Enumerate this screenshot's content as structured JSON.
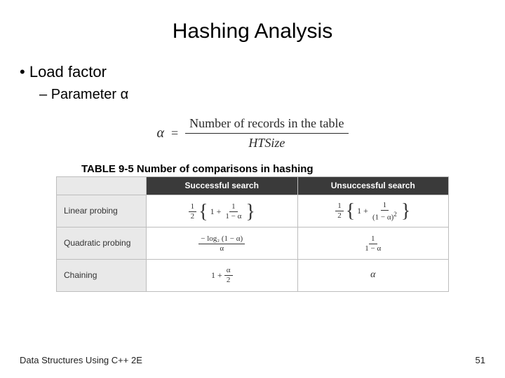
{
  "title": "Hashing Analysis",
  "bullets": {
    "l1": "Load factor",
    "l2": "Parameter α"
  },
  "formula": {
    "lhs": "α",
    "eq": "=",
    "num": "Number of records in the table",
    "den": "HTSize"
  },
  "table": {
    "caption": "TABLE 9-5 Number of comparisons in hashing",
    "headers": {
      "c0": "",
      "c1": "Successful search",
      "c2": "Unsuccessful search"
    },
    "rows": {
      "r0": {
        "label": "Linear probing"
      },
      "r1": {
        "label": "Quadratic probing"
      },
      "r2": {
        "label": "Chaining"
      }
    },
    "cells": {
      "lp_s": {
        "half": "1",
        "two": "2",
        "one": "1",
        "plus": "+",
        "innerNum": "1",
        "innerDen": "1 − α"
      },
      "lp_u": {
        "half": "1",
        "two": "2",
        "one": "1",
        "plus": "+",
        "innerNum": "1",
        "innerDen": "(1 − α)",
        "sq": "2"
      },
      "qp_s": {
        "num": "− log₂ (1 − α)",
        "den": "α"
      },
      "qp_u": {
        "num": "1",
        "den": "1 − α"
      },
      "ch_s": {
        "one": "1",
        "plus": "+",
        "num": "α",
        "den": "2"
      },
      "ch_u": {
        "val": "α"
      }
    }
  },
  "footer": {
    "left": "Data Structures Using C++ 2E",
    "right": "51"
  }
}
